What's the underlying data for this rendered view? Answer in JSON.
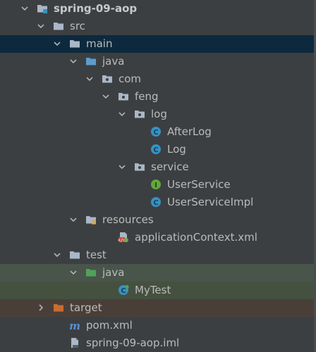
{
  "tree": {
    "nodes": [
      {
        "label": "spring-09-aop",
        "icon": "module-folder-icon",
        "arrow": "expanded",
        "level": 0,
        "style": "bold"
      },
      {
        "label": "src",
        "icon": "folder-icon",
        "arrow": "expanded",
        "level": 1
      },
      {
        "label": "main",
        "icon": "folder-icon",
        "arrow": "expanded",
        "level": 2,
        "state": "selected"
      },
      {
        "label": "java",
        "icon": "source-root-folder-icon",
        "arrow": "expanded",
        "level": 3
      },
      {
        "label": "com",
        "icon": "package-icon",
        "arrow": "expanded",
        "level": 4
      },
      {
        "label": "feng",
        "icon": "package-icon",
        "arrow": "expanded",
        "level": 5
      },
      {
        "label": "log",
        "icon": "package-icon",
        "arrow": "expanded",
        "level": 6
      },
      {
        "label": "AfterLog",
        "icon": "java-class-icon",
        "arrow": "none",
        "level": 7
      },
      {
        "label": "Log",
        "icon": "java-class-icon",
        "arrow": "none",
        "level": 7
      },
      {
        "label": "service",
        "icon": "package-icon",
        "arrow": "expanded",
        "level": 6
      },
      {
        "label": "UserService",
        "icon": "java-interface-icon",
        "arrow": "none",
        "level": 7
      },
      {
        "label": "UserServiceImpl",
        "icon": "java-class-icon",
        "arrow": "none",
        "level": 7
      },
      {
        "label": "resources",
        "icon": "resources-folder-icon",
        "arrow": "expanded",
        "level": 3
      },
      {
        "label": "applicationContext.xml",
        "icon": "spring-xml-icon",
        "arrow": "none",
        "level": 5
      },
      {
        "label": "test",
        "icon": "folder-icon",
        "arrow": "expanded",
        "level": 2
      },
      {
        "label": "java",
        "icon": "test-source-folder-icon",
        "arrow": "expanded",
        "level": 3,
        "state": "test"
      },
      {
        "label": "MyTest",
        "icon": "java-test-class-icon",
        "arrow": "none",
        "level": 5,
        "state": "test"
      },
      {
        "label": "target",
        "icon": "excluded-folder-icon",
        "arrow": "collapsed",
        "level": 1,
        "state": "excluded"
      },
      {
        "label": "pom.xml",
        "icon": "maven-icon",
        "arrow": "none",
        "level": 2
      },
      {
        "label": "spring-09-aop.iml",
        "icon": "iml-file-icon",
        "arrow": "none",
        "level": 2
      }
    ]
  },
  "colors": {
    "background": "#3c3f41",
    "selected_row": "#0d293e",
    "test_row": "#49544a",
    "excluded_row": "#4a3f38",
    "text": "#bbbbbb",
    "folder": "#a9b7c6",
    "source_root": "#5c9ccf",
    "test_root": "#4ea359",
    "excluded": "#c86d31",
    "class_badge": "#3592c4",
    "interface_badge": "#62a73b"
  }
}
